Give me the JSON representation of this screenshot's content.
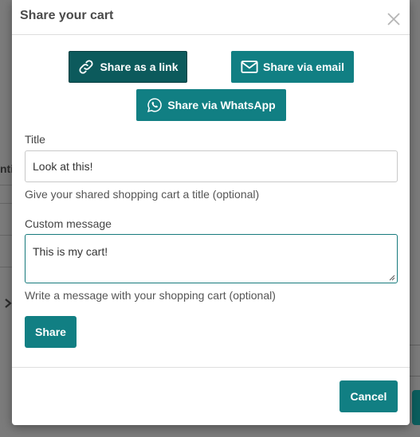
{
  "modal": {
    "title": "Share your cart",
    "close_icon": "close-icon"
  },
  "share_options": {
    "link": {
      "label": "Share as a link",
      "icon": "link-icon",
      "color": "#0c5a5c"
    },
    "email": {
      "label": "Share via email",
      "icon": "mail-icon",
      "color": "#117f83"
    },
    "whatsapp": {
      "label": "Share via WhatsApp",
      "icon": "whatsapp-icon",
      "color": "#117f83"
    }
  },
  "form": {
    "title_label": "Title",
    "title_value": "Look at this!",
    "title_hint": "Give your shared shopping cart a title (optional)",
    "message_label": "Custom message",
    "message_value": "This is my cart!",
    "message_hint": "Write a message with your shopping cart (optional)",
    "share_label": "Share"
  },
  "footer": {
    "cancel_label": "Cancel"
  },
  "background": {
    "fragment_text": "nti"
  }
}
